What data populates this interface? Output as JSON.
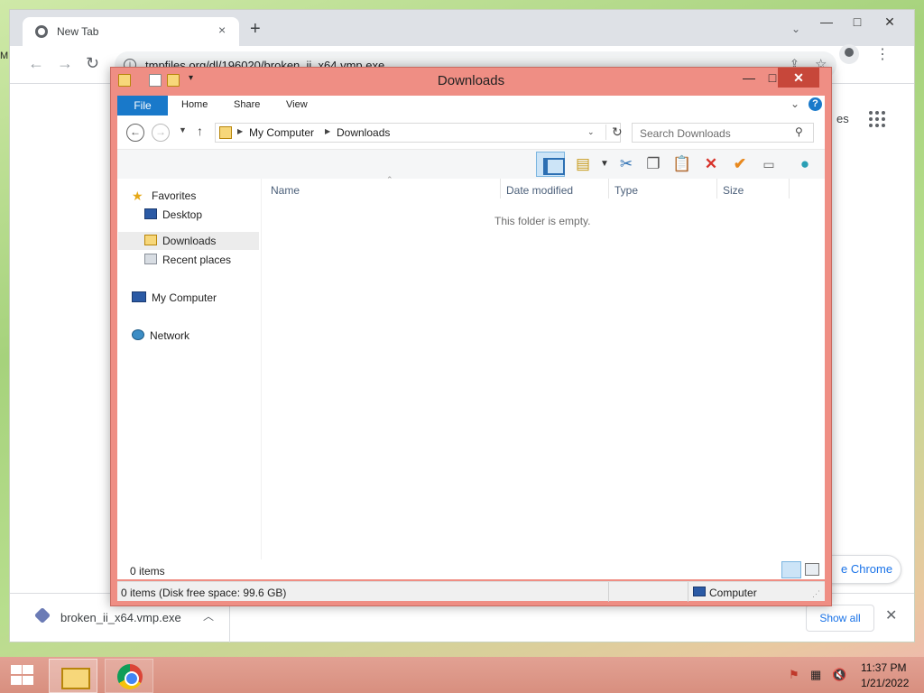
{
  "chrome": {
    "tab_title": "New Tab",
    "tab_close": "×",
    "new_tab": "+",
    "window_min": "—",
    "window_max": "□",
    "window_close": "✕",
    "url": "tmpfiles.org/dl/196020/broken_ii_x64.vmp.exe",
    "partial_text_right": "es",
    "customize_pill_text": "e Chrome",
    "left_edge_fragment": "M",
    "download": {
      "file_name": "broken_ii_x64.vmp.exe",
      "show_all": "Show all"
    }
  },
  "explorer": {
    "title": "Downloads",
    "ribbon_tabs": [
      "File",
      "Home",
      "Share",
      "View"
    ],
    "help": "?",
    "breadcrumb": [
      "My Computer",
      "Downloads"
    ],
    "search_placeholder": "Search Downloads",
    "nav": {
      "favorites": "Favorites",
      "desktop": "Desktop",
      "downloads": "Downloads",
      "recent": "Recent places",
      "computer": "My Computer",
      "network": "Network"
    },
    "columns": [
      "Name",
      "Date modified",
      "Type",
      "Size"
    ],
    "empty_message": "This folder is empty.",
    "items_count": "0 items",
    "status_text": "0 items (Disk free space: 99.6 GB)",
    "status_location": "Computer"
  },
  "taskbar": {
    "time": "11:37 PM",
    "date": "1/21/2022"
  },
  "colors": {
    "explorer_frame": "#ef8e84",
    "close_button": "#c7473a",
    "file_tab": "#1979ca",
    "taskbar": "#d88f7f"
  }
}
